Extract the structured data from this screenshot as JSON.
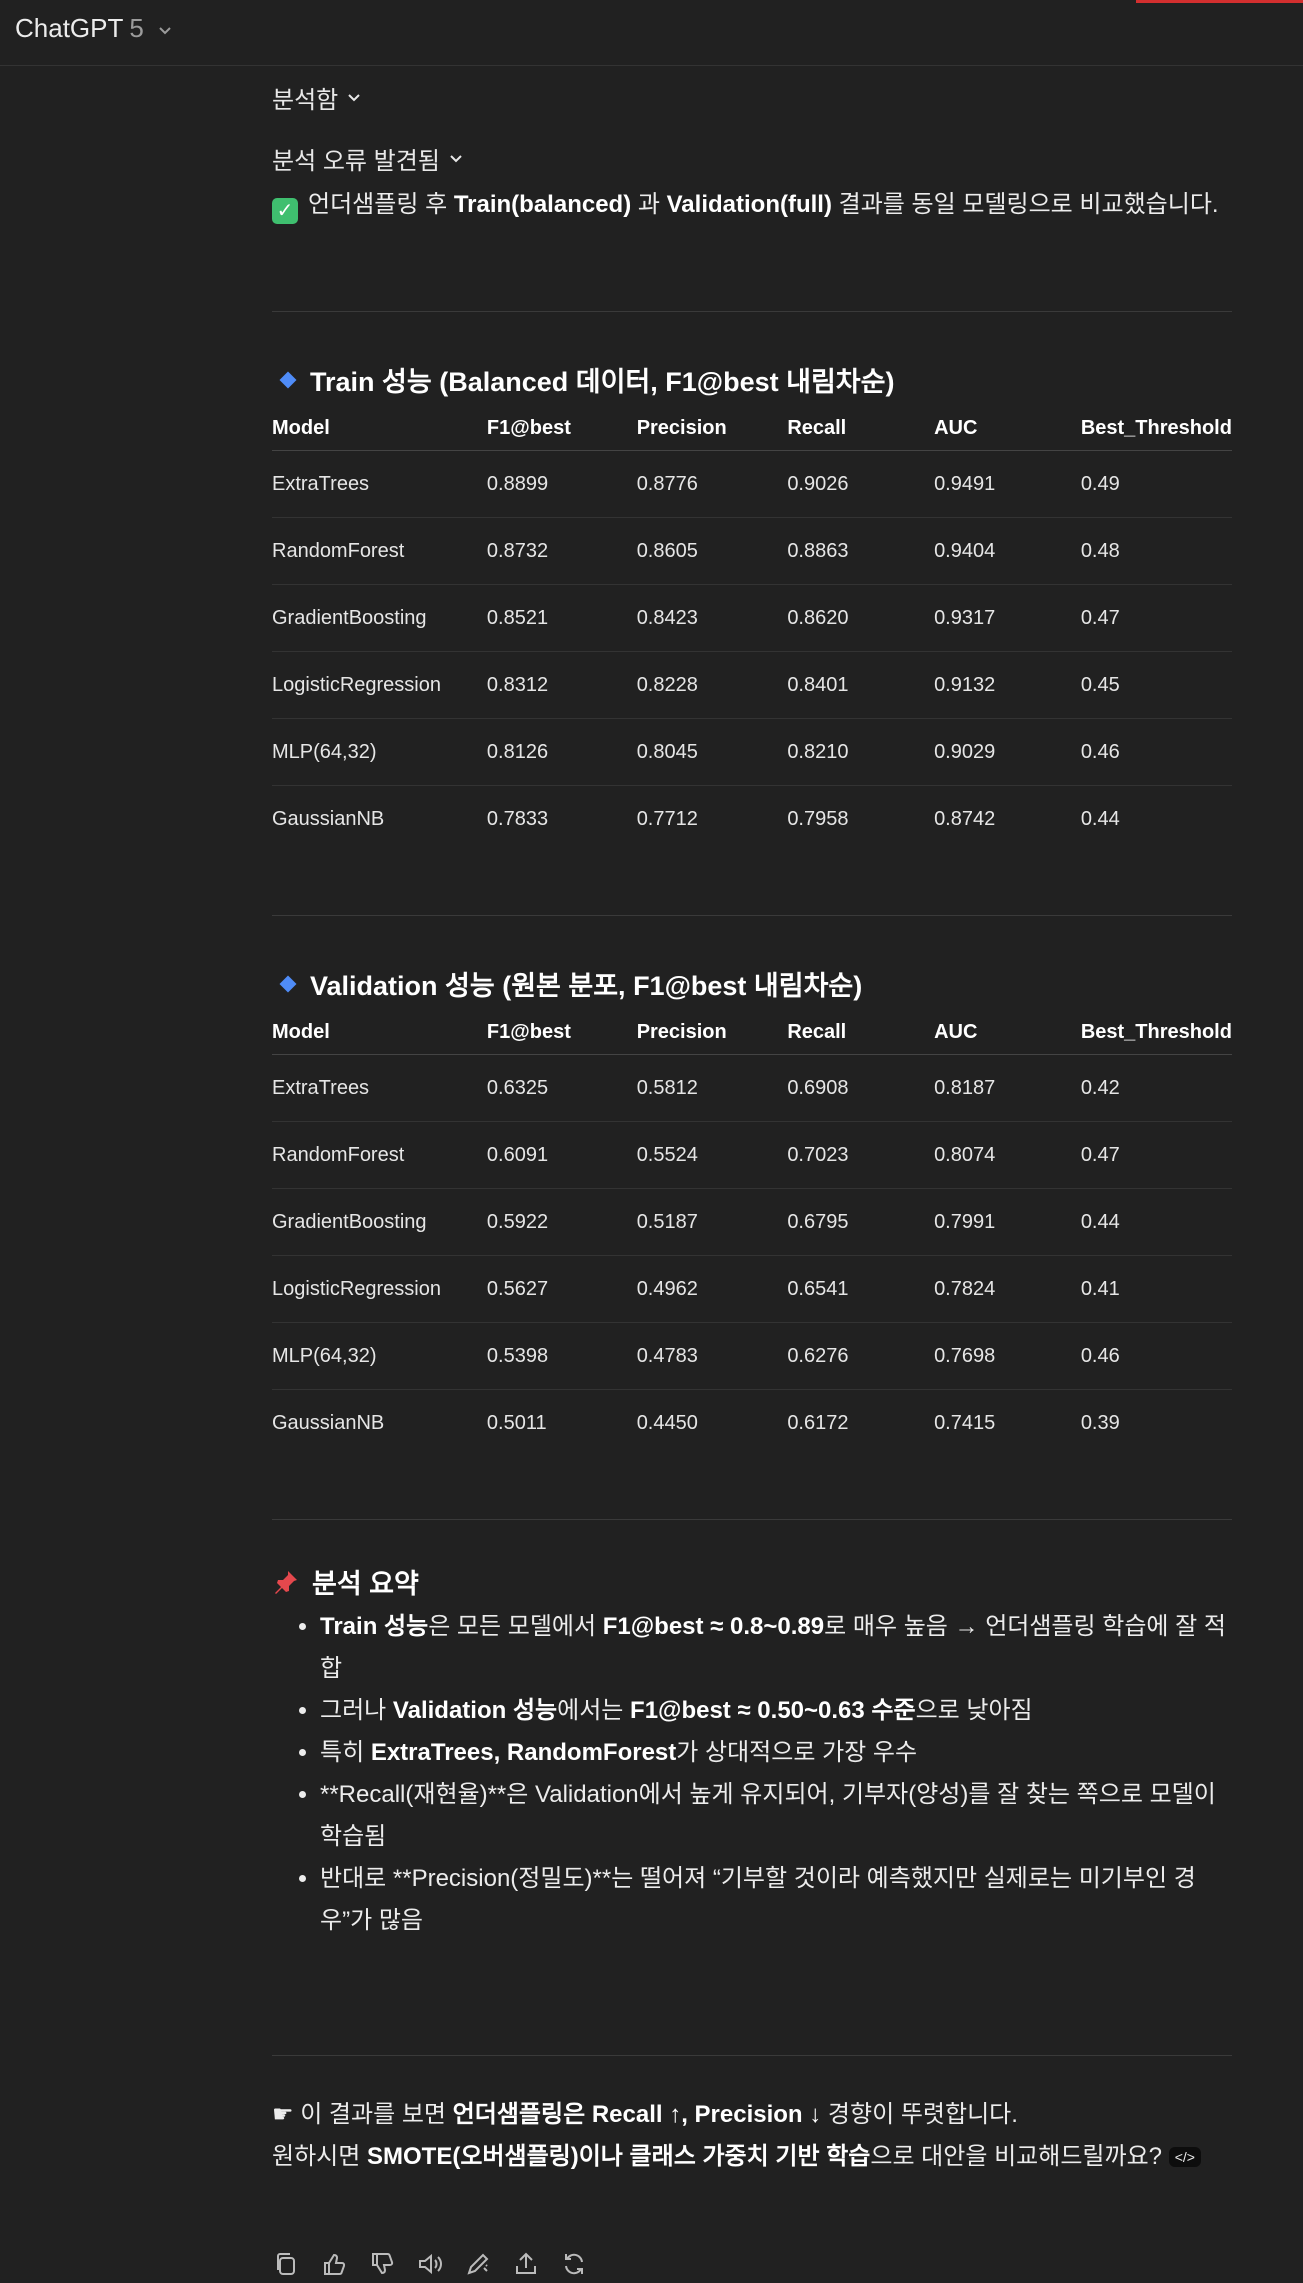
{
  "header": {
    "brand": "ChatGPT",
    "version": "5"
  },
  "collapsers": {
    "analyzed": "분석함",
    "error": "분석 오류 발견됨"
  },
  "intro": {
    "p1": "언더샘플링 후 ",
    "b1": "Train(balanced)",
    "p2": " 과 ",
    "b2": "Validation(full)",
    "p3": " 결과를 동일 모델링으로 비교했습니다."
  },
  "train": {
    "title": "Train 성능 (Balanced 데이터, F1@best 내림차순)",
    "headers": [
      "Model",
      "F1@best",
      "Precision",
      "Recall",
      "AUC",
      "Best_Threshold"
    ],
    "rows": [
      [
        "ExtraTrees",
        "0.8899",
        "0.8776",
        "0.9026",
        "0.9491",
        "0.49"
      ],
      [
        "RandomForest",
        "0.8732",
        "0.8605",
        "0.8863",
        "0.9404",
        "0.48"
      ],
      [
        "GradientBoosting",
        "0.8521",
        "0.8423",
        "0.8620",
        "0.9317",
        "0.47"
      ],
      [
        "LogisticRegression",
        "0.8312",
        "0.8228",
        "0.8401",
        "0.9132",
        "0.45"
      ],
      [
        "MLP(64,32)",
        "0.8126",
        "0.8045",
        "0.8210",
        "0.9029",
        "0.46"
      ],
      [
        "GaussianNB",
        "0.7833",
        "0.7712",
        "0.7958",
        "0.8742",
        "0.44"
      ]
    ]
  },
  "validation": {
    "title": "Validation 성능 (원본 분포, F1@best 내림차순)",
    "headers": [
      "Model",
      "F1@best",
      "Precision",
      "Recall",
      "AUC",
      "Best_Threshold"
    ],
    "rows": [
      [
        "ExtraTrees",
        "0.6325",
        "0.5812",
        "0.6908",
        "0.8187",
        "0.42"
      ],
      [
        "RandomForest",
        "0.6091",
        "0.5524",
        "0.7023",
        "0.8074",
        "0.47"
      ],
      [
        "GradientBoosting",
        "0.5922",
        "0.5187",
        "0.6795",
        "0.7991",
        "0.44"
      ],
      [
        "LogisticRegression",
        "0.5627",
        "0.4962",
        "0.6541",
        "0.7824",
        "0.41"
      ],
      [
        "MLP(64,32)",
        "0.5398",
        "0.4783",
        "0.6276",
        "0.7698",
        "0.46"
      ],
      [
        "GaussianNB",
        "0.5011",
        "0.4450",
        "0.6172",
        "0.7415",
        "0.39"
      ]
    ]
  },
  "summary": {
    "title": "분석 요약",
    "b1_bold1": "Train 성능",
    "b1_t1": "은 모든 모델에서 ",
    "b1_bold2": "F1@best ≈ 0.8~0.89",
    "b1_t2": "로 매우 높음 → 언더샘플링 학습에 잘 적합",
    "b2_t1": "그러나 ",
    "b2_bold1": "Validation 성능",
    "b2_t2": "에서는 ",
    "b2_bold2": "F1@best ≈ 0.50~0.63 수준",
    "b2_t3": "으로 낮아짐",
    "b3_t1": "특히 ",
    "b3_bold1": "ExtraTrees, RandomForest",
    "b3_t2": "가 상대적으로 가장 우수",
    "b4": "**Recall(재현율)**은 Validation에서 높게 유지되어, 기부자(양성)를 잘 찾는 쪽으로 모델이 학습됨",
    "b5": "반대로 **Precision(정밀도)**는 떨어져 “기부할 것이라 예측했지만 실제로는 미기부인 경우”가 많음"
  },
  "footer": {
    "t1": "이 결과를 보면 ",
    "bold1": "언더샘플링은 Recall ↑, Precision ↓",
    "t2": " 경향이 뚜렷합니다.",
    "t3": "원하시면 ",
    "bold2": "SMOTE(오버샘플링)이나 클래스 가중치 기반 학습",
    "t4": "으로 대안을 비교해드릴까요?"
  },
  "icons": [
    "copy-icon",
    "thumbs-up-icon",
    "thumbs-down-icon",
    "read-aloud-icon",
    "edit-icon",
    "share-icon",
    "regenerate-icon"
  ],
  "colors": {
    "background": "#212121",
    "accent_diamond": "#4f8cf7",
    "check_green": "#3fbf6f",
    "top_red": "#d32f2f"
  }
}
